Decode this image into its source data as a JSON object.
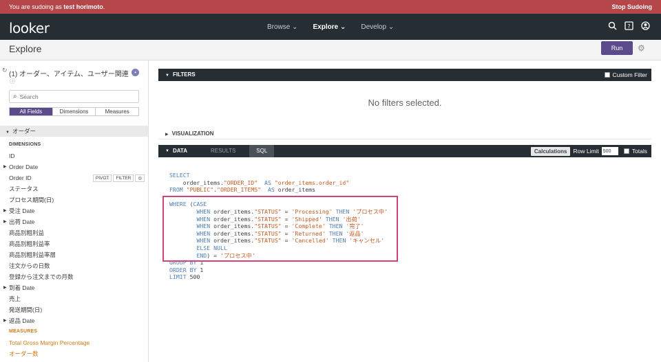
{
  "sudo": {
    "prefix": "You are sudoing as ",
    "user": "test horimoto",
    "suffix": ".",
    "stop_label": "Stop Sudoing"
  },
  "nav": {
    "logo": "looker",
    "links": [
      {
        "label": "Browse ⌄"
      },
      {
        "label": "Explore ⌄"
      },
      {
        "label": "Develop ⌄"
      }
    ],
    "icons": [
      "search-icon",
      "help-icon",
      "user-icon"
    ]
  },
  "header": {
    "title": "Explore",
    "run_label": "Run"
  },
  "sidebar": {
    "explore_name": "(1) オーダー、アイテム、ユーザー関連",
    "search_placeholder": "Search",
    "tabs": [
      "All Fields",
      "Dimensions",
      "Measures"
    ],
    "view_name": "オーダー",
    "fields": [
      {
        "label": "DIMENSIONS",
        "kind": "section"
      },
      {
        "label": "ID"
      },
      {
        "label": "Order Date",
        "group": true
      },
      {
        "label": "Order ID",
        "actions": [
          "PIVOT",
          "FILTER"
        ]
      },
      {
        "label": "ステータス"
      },
      {
        "label": "プロセス期間(日)"
      },
      {
        "label": "受注 Date",
        "group": true
      },
      {
        "label": "出荷 Date",
        "group": true
      },
      {
        "label": "商品別粗利益"
      },
      {
        "label": "商品別粗利益率"
      },
      {
        "label": "商品別粗利益率層"
      },
      {
        "label": "注文からの日数"
      },
      {
        "label": "登録から注文までの月数"
      },
      {
        "label": "到着 Date",
        "group": true
      },
      {
        "label": "売上"
      },
      {
        "label": "発送期間(日)"
      },
      {
        "label": "返品 Date",
        "group": true
      },
      {
        "label": "MEASURES",
        "kind": "section-measure"
      },
      {
        "label": "Total Gross Margin Percentage",
        "kind": "measure"
      },
      {
        "label": "オーダー数",
        "kind": "measure"
      }
    ]
  },
  "filters": {
    "title": "FILTERS",
    "custom_filter_label": "Custom Filter",
    "empty_text": "No filters selected."
  },
  "visualization": {
    "title": "VISUALIZATION"
  },
  "data_section": {
    "title": "DATA",
    "tabs": [
      "RESULTS",
      "SQL"
    ],
    "calculations_label": "Calculations",
    "row_limit_label": "Row Limit",
    "row_limit_value": "500",
    "totals_label": "Totals"
  },
  "sql": {
    "lines": [
      "SELECT",
      "    order_items.\"ORDER_ID\"  AS \"order_items.order_id\"",
      "FROM \"PUBLIC\".\"ORDER_ITEMS\"  AS order_items",
      "",
      "WHERE (CASE",
      "        WHEN order_items.\"STATUS\" = 'Processing' THEN 'プロセス中'",
      "        WHEN order_items.\"STATUS\" = 'Shipped' THEN '出荷'",
      "        WHEN order_items.\"STATUS\" = 'Complete' THEN '完了'",
      "        WHEN order_items.\"STATUS\" = 'Returned' THEN '返品'",
      "        WHEN order_items.\"STATUS\" = 'Cancelled' THEN 'キャンセル'",
      "        ELSE NULL",
      "        END) = 'プロセス中'",
      "GROUP BY 1",
      "ORDER BY 1",
      "LIMIT 500"
    ]
  },
  "colors": {
    "sudo_bar": "#b5474a",
    "nav_bar": "#262d33",
    "accent": "#5b4b8a",
    "measure": "#d27b17",
    "highlight": "#d0427b"
  }
}
